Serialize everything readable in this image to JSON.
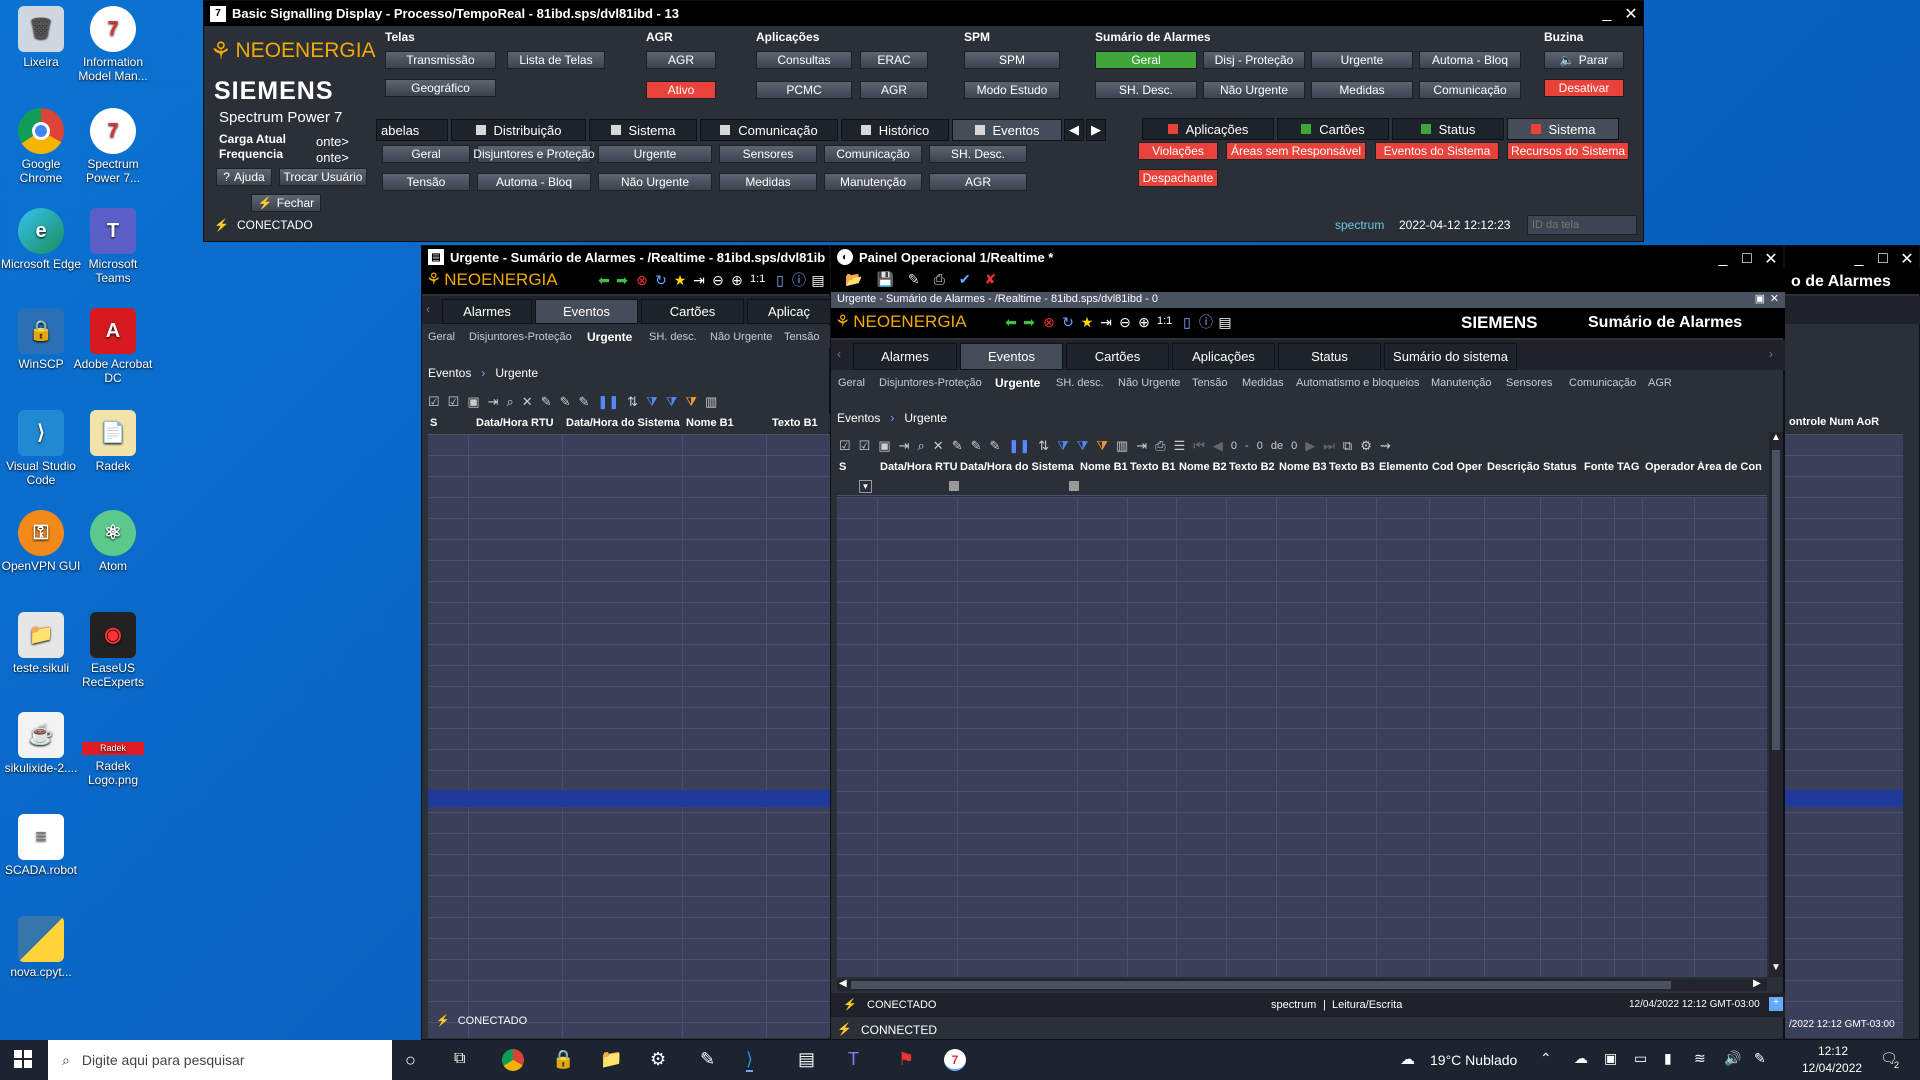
{
  "desktop": {
    "icons": [
      {
        "label": "Lixeira"
      },
      {
        "label": "Information Model Man..."
      },
      {
        "label": "Google Chrome"
      },
      {
        "label": "Spectrum Power 7..."
      },
      {
        "label": "Microsoft Edge"
      },
      {
        "label": "Microsoft Teams"
      },
      {
        "label": "WinSCP"
      },
      {
        "label": "Adobe Acrobat DC"
      },
      {
        "label": "Visual Studio Code"
      },
      {
        "label": "Radek"
      },
      {
        "label": "OpenVPN GUI"
      },
      {
        "label": "Atom"
      },
      {
        "label": "teste.sikuli"
      },
      {
        "label": "EaseUS RecExperts"
      },
      {
        "label": "sikulixide-2...."
      },
      {
        "label": "Radek Logo.png"
      },
      {
        "label": "SCADA.robot"
      },
      {
        "label": "nova.cpyt..."
      }
    ],
    "radek_logo_text": "Radek"
  },
  "bsd": {
    "title": "Basic Signalling Display - Processo/TempoReal - 81ibd.sps/dvl81ibd - 13",
    "brand": "NEOENERGIA",
    "siemens": "SIEMENS",
    "product": "Spectrum Power 7",
    "carga": "Carga Atual",
    "freq": "Frequencia",
    "carga_val": "onte>",
    "freq_val": "onte>",
    "ajuda": "Ajuda",
    "trocar": "Trocar Usuário",
    "fechar": "Fechar",
    "status": "CONECTADO",
    "user": "spectrum",
    "datetime": "2022-04-12 12:12:23",
    "id_placeholder": "ID da tela",
    "sections": {
      "telas": "Telas",
      "agr": "AGR",
      "aplicacoes": "Aplicações",
      "spm": "SPM",
      "sumario": "Sumário de Alarmes",
      "buzina": "Buzina"
    },
    "telas_btns": [
      "Transmissão",
      "Lista de Telas",
      "Geográfico"
    ],
    "agr_btns": [
      "AGR",
      "Ativo"
    ],
    "apl_btns": [
      "Consultas",
      "ERAC",
      "PCMC",
      "AGR"
    ],
    "spm_btns": [
      "SPM",
      "Modo Estudo"
    ],
    "sum_btns": [
      "Geral",
      "Disj - Proteção",
      "Urgente",
      "Automa - Bloq",
      "SH. Desc.",
      "Não Urgente",
      "Medidas",
      "Comunicação"
    ],
    "buzina_btns": [
      "Parar",
      "Desativar"
    ],
    "tabs": [
      "abelas",
      "Distribuição",
      "Sistema",
      "Comunicação",
      "Histórico",
      "Eventos"
    ],
    "event_btns": [
      "Geral",
      "Disjuntores e Proteção",
      "Urgente",
      "Sensores",
      "Comunicação",
      "SH. Desc.",
      "Tensão",
      "Automa - Bloq",
      "Não Urgente",
      "Medidas",
      "Manutenção",
      "AGR"
    ],
    "alarm_tabs": [
      "Aplicações",
      "Cartões",
      "Status",
      "Sistema"
    ],
    "alarm_btns": [
      "Violações",
      "Áreas sem Responsável",
      "Eventos do Sistema",
      "Recursos do Sistema",
      "Despachante"
    ]
  },
  "urgente": {
    "title": "Urgente - Sumário de Alarmes - /Realtime - 81ibd.sps/dvl81ib",
    "brand": "NEOENERGIA",
    "tabs": [
      "Alarmes",
      "Eventos",
      "Cartões",
      "Aplicaç"
    ],
    "subtabs": [
      "Geral",
      "Disjuntores-Proteção",
      "Urgente",
      "SH. desc.",
      "Não Urgente",
      "Tensão"
    ],
    "breadcrumb": [
      "Eventos",
      "Urgente"
    ],
    "columns": [
      "S",
      "Data/Hora RTU",
      "Data/Hora do Sistema",
      "Nome B1",
      "Texto B1"
    ],
    "status": "CONECTADO",
    "one_to_one": "1:1"
  },
  "painel": {
    "title": "Painel Operacional 1/Realtime *",
    "inner_title": "Urgente - Sumário de Alarmes - /Realtime - 81ibd.sps/dvl81ibd - 0",
    "brand": "NEOENERGIA",
    "siemens": "SIEMENS",
    "heading": "Sumário de Alarmes",
    "tabs": [
      "Alarmes",
      "Eventos",
      "Cartões",
      "Aplicações",
      "Status",
      "Sumário do sistema"
    ],
    "subtabs": [
      "Geral",
      "Disjuntores-Proteção",
      "Urgente",
      "SH. desc.",
      "Não Urgente",
      "Tensão",
      "Medidas",
      "Automatismo e bloqueios",
      "Manutenção",
      "Sensores",
      "Comunicação",
      "AGR"
    ],
    "breadcrumb": [
      "Eventos",
      "Urgente"
    ],
    "pager": {
      "from": "0",
      "dash": "-",
      "to": "0",
      "de": "de",
      "total": "0"
    },
    "columns": [
      "S",
      "Data/Hora RTU",
      "Data/Hora do Sistema",
      "Nome B1",
      "Texto B1",
      "Nome B2",
      "Texto B2",
      "Nome B3",
      "Texto B3",
      "Elemento",
      "Cod Oper",
      "Descrição",
      "Status",
      "Fonte",
      "TAG",
      "Operador",
      "Área de Con"
    ],
    "status": "CONECTADO",
    "user": "spectrum",
    "mode": "Leitura/Escrita",
    "datetime": "12/04/2022 12:12 GMT-03:00",
    "connected": "CONNECTED",
    "one_to_one": "1:1"
  },
  "right_win": {
    "title_partial": "o de Alarmes",
    "col": "ontrole Num AoR",
    "datetime": "/2022 12:12 GMT-03:00"
  },
  "taskbar": {
    "search_placeholder": "Digite aqui para pesquisar",
    "weather": "19°C  Nublado",
    "time": "12:12",
    "date": "12/04/2022",
    "notif": "2"
  }
}
